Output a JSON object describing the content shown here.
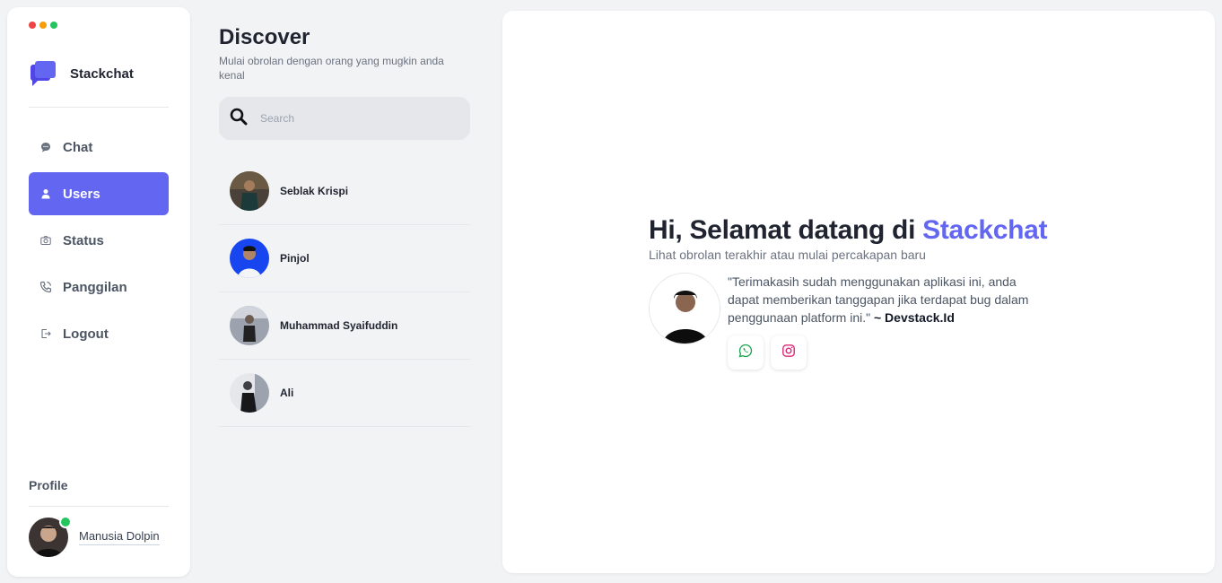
{
  "window": {
    "dot_colors": [
      "#ef4444",
      "#f59e0b",
      "#22c55e"
    ]
  },
  "brand": {
    "name": "Stackchat",
    "color": "#6366f1"
  },
  "nav": {
    "items": [
      {
        "label": "Chat",
        "icon": "chat-bubble-icon",
        "active": false
      },
      {
        "label": "Users",
        "icon": "user-icon",
        "active": true
      },
      {
        "label": "Status",
        "icon": "camera-icon",
        "active": false
      },
      {
        "label": "Panggilan",
        "icon": "phone-icon",
        "active": false
      },
      {
        "label": "Logout",
        "icon": "logout-icon",
        "active": false
      }
    ]
  },
  "profile": {
    "title": "Profile",
    "name": "Manusia Dolpin",
    "online": true
  },
  "discover": {
    "title": "Discover",
    "subtitle": "Mulai obrolan dengan orang yang mugkin anda kenal",
    "search_placeholder": "Search",
    "users": [
      {
        "name": "Seblak Krispi"
      },
      {
        "name": "Pinjol"
      },
      {
        "name": "Muhammad Syaifuddin"
      },
      {
        "name": "Ali"
      }
    ]
  },
  "welcome": {
    "title_prefix": "Hi, Selamat datang di",
    "title_brand": "Stackchat",
    "subtitle": "Lihat obrolan terakhir atau mulai percakapan baru",
    "quote": "\"Terimakasih sudah menggunakan aplikasi ini, anda dapat memberikan tanggapan jika terdapat bug dalam penggunaan platform ini.\"",
    "quote_author": "~ Devstack.Id",
    "socials": [
      {
        "icon": "whatsapp-icon",
        "color": "#16a34a"
      },
      {
        "icon": "instagram-icon",
        "color": "#db2777"
      }
    ]
  }
}
